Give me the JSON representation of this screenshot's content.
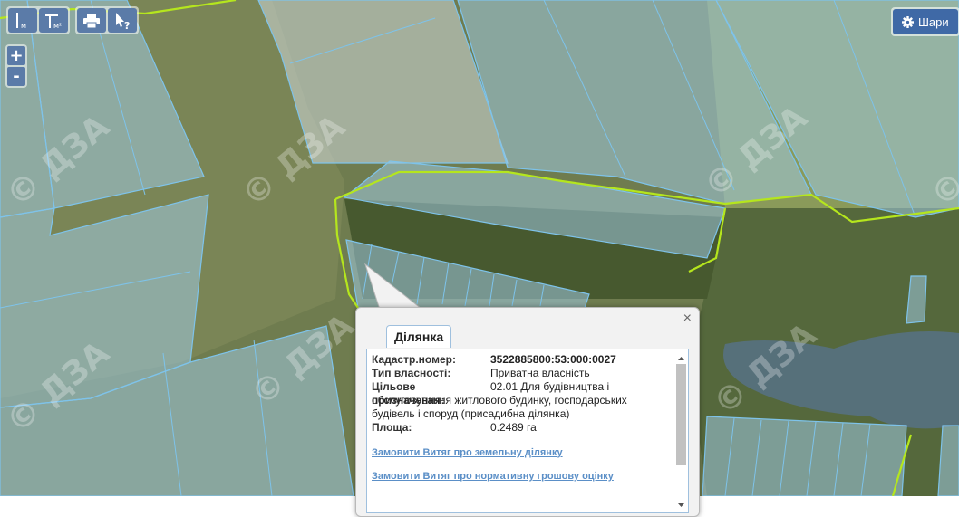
{
  "map": {
    "watermark": "© ДЗА"
  },
  "toolbar": {
    "measure_length_sub": "м",
    "measure_area_sub": "м²"
  },
  "zoom": {
    "in_label": "+",
    "out_label": "-"
  },
  "layers": {
    "label": "Шари"
  },
  "popup": {
    "close": "×",
    "tab": "Ділянка",
    "rows": [
      {
        "key": "Кадастр.номер:",
        "value": "3522885800:53:000:0027"
      },
      {
        "key": "Тип власності:",
        "value": "Приватна власність"
      },
      {
        "key": "Цільове призначення:",
        "value": "02.01 Для будівництва і обслуговування житлового будинку, господарських будівель і споруд (присадибна ділянка)"
      },
      {
        "key": "Площа:",
        "value": "0.2489 га"
      }
    ],
    "links": [
      "Замовити Витяг про земельну ділянку",
      "Замовити Витяг про нормативну грошову оцінку"
    ]
  },
  "colors": {
    "terrain": "#6c7a4c",
    "parcel_fill": "#9fc8e0",
    "parcel_stroke": "#7ec3ea",
    "boundary": "#b5e61d",
    "water": "#56707a",
    "button": "#5b7ba8"
  }
}
